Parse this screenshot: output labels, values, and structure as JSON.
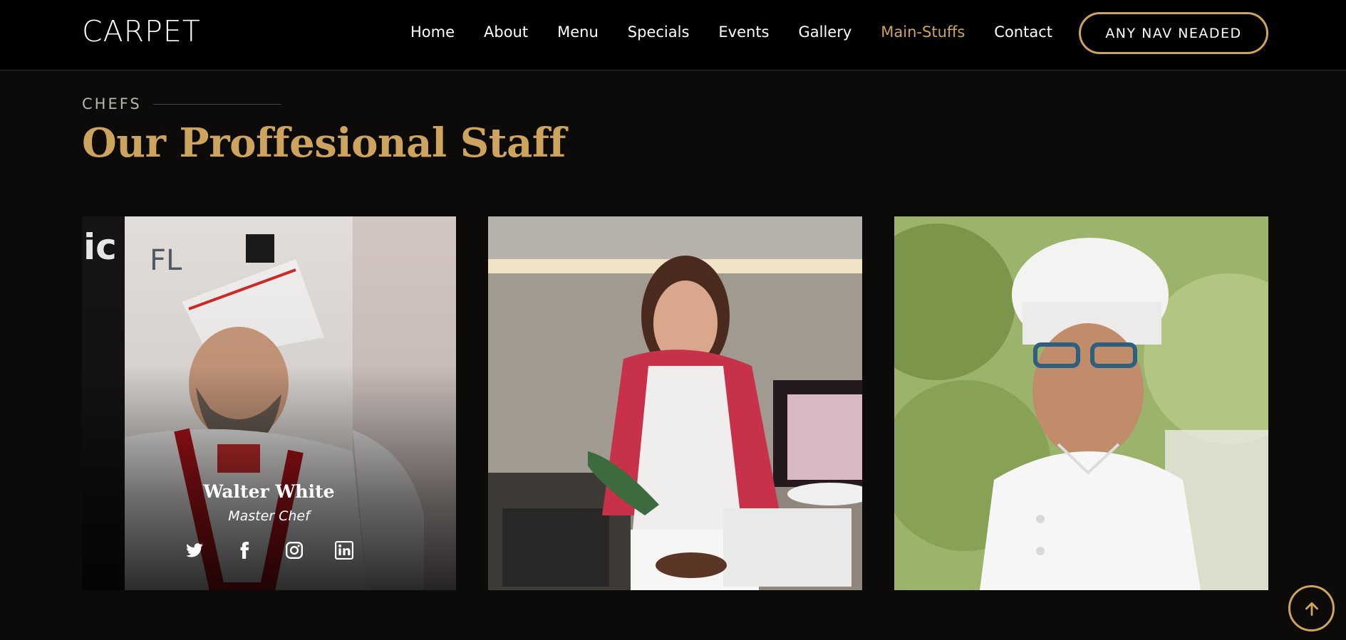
{
  "header": {
    "logo": "CARPET",
    "nav": [
      {
        "label": "Home"
      },
      {
        "label": "About"
      },
      {
        "label": "Menu"
      },
      {
        "label": "Specials"
      },
      {
        "label": "Events"
      },
      {
        "label": "Gallery"
      },
      {
        "label": "Main-Stuffs",
        "active": true
      },
      {
        "label": "Contact"
      }
    ],
    "cta_label": "ANY NAV NEADED"
  },
  "section": {
    "eyebrow": "CHEFS",
    "title": "Our Proffesional Staff"
  },
  "chefs": [
    {
      "name": "Walter White",
      "role": "Master Chef",
      "socials": [
        "twitter-icon",
        "facebook-icon",
        "instagram-icon",
        "linkedin-icon"
      ]
    },
    {},
    {}
  ],
  "colors": {
    "accent": "#cda45e",
    "background": "#0c0b09",
    "navbar": "#000000",
    "text": "#ffffff"
  },
  "icons": {
    "back_to_top": "arrow-up-icon"
  }
}
